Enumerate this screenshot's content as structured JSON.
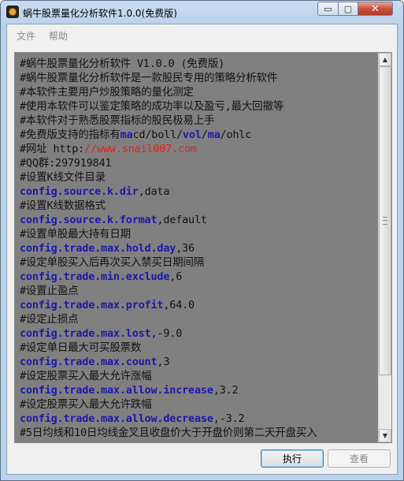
{
  "window": {
    "title": "蜗牛股票量化分析软件1.0.0(免费版)",
    "controls": {
      "minimize": "▭",
      "maximize": "▢",
      "close": "✕"
    }
  },
  "menu": {
    "file": "文件",
    "help": "帮助"
  },
  "editor": {
    "lines": [
      [
        {
          "t": "#蜗牛股票量化分析软件 V1.0.0 (免费版)",
          "s": "plain"
        }
      ],
      [
        {
          "t": "#蜗牛股票量化分析软件是一款股民专用的策略分析软件",
          "s": "plain"
        }
      ],
      [
        {
          "t": "#本软件主要用户炒股策略的量化测定",
          "s": "plain"
        }
      ],
      [
        {
          "t": "#使用本软件可以鉴定策略的成功率以及盈亏,最大回撤等",
          "s": "plain"
        }
      ],
      [
        {
          "t": "#本软件对于熟悉股票指标的股民极易上手",
          "s": "plain"
        }
      ],
      [
        {
          "t": "#免费版支持的指标有",
          "s": "plain"
        },
        {
          "t": "ma",
          "s": "kw"
        },
        {
          "t": "cd/boll/",
          "s": "plain"
        },
        {
          "t": "vol",
          "s": "kw"
        },
        {
          "t": "/",
          "s": "plain"
        },
        {
          "t": "ma",
          "s": "kw"
        },
        {
          "t": "/ohlc",
          "s": "plain"
        }
      ],
      [
        {
          "t": "#网址 http:",
          "s": "plain"
        },
        {
          "t": "//www.snail007.com",
          "s": "red"
        }
      ],
      [
        {
          "t": "#QQ群:297919841",
          "s": "plain"
        }
      ],
      [
        {
          "t": "#设置K线文件目录",
          "s": "plain"
        }
      ],
      [
        {
          "t": "config.source.k.dir",
          "s": "kw"
        },
        {
          "t": ",data",
          "s": "plain"
        }
      ],
      [
        {
          "t": "#设置K线数据格式",
          "s": "plain"
        }
      ],
      [
        {
          "t": "config.source.k.format",
          "s": "kw"
        },
        {
          "t": ",default",
          "s": "plain"
        }
      ],
      [
        {
          "t": "#设置单股最大持有日期",
          "s": "plain"
        }
      ],
      [
        {
          "t": "config.trade.max.hold.day",
          "s": "kw"
        },
        {
          "t": ",36",
          "s": "plain"
        }
      ],
      [
        {
          "t": "#设定单股买入后再次买入禁买日期间隔",
          "s": "plain"
        }
      ],
      [
        {
          "t": "config.trade.min.exclude",
          "s": "kw"
        },
        {
          "t": ",6",
          "s": "plain"
        }
      ],
      [
        {
          "t": "#设置止盈点",
          "s": "plain"
        }
      ],
      [
        {
          "t": "config.trade.max.profit",
          "s": "kw"
        },
        {
          "t": ",64.0",
          "s": "plain"
        }
      ],
      [
        {
          "t": "#设定止损点",
          "s": "plain"
        }
      ],
      [
        {
          "t": "config.trade.max.lost",
          "s": "kw"
        },
        {
          "t": ",-9.0",
          "s": "plain"
        }
      ],
      [
        {
          "t": "#设定单日最大可买股票数",
          "s": "plain"
        }
      ],
      [
        {
          "t": "config.trade.max.count",
          "s": "kw"
        },
        {
          "t": ",3",
          "s": "plain"
        }
      ],
      [
        {
          "t": "#设定股票买入最大允许涨幅",
          "s": "plain"
        }
      ],
      [
        {
          "t": "config.trade.max.allow.increase",
          "s": "kw"
        },
        {
          "t": ",3.2",
          "s": "plain"
        }
      ],
      [
        {
          "t": "#设定股票买入最大允许跌幅",
          "s": "plain"
        }
      ],
      [
        {
          "t": "config.trade.max.allow.decrease",
          "s": "kw"
        },
        {
          "t": ",-3.2",
          "s": "plain"
        }
      ],
      [
        {
          "t": "#5日均线和10日均线金叉且收盘价大于开盘价则第二天开盘买入",
          "s": "plain"
        }
      ]
    ],
    "colors": {
      "background": "#808080",
      "keyword": "#1a1aa8",
      "url": "#e0201c"
    }
  },
  "scrollbar": {
    "up": "▲",
    "down": "▼"
  },
  "buttons": {
    "run": "执行",
    "view": "查看"
  }
}
